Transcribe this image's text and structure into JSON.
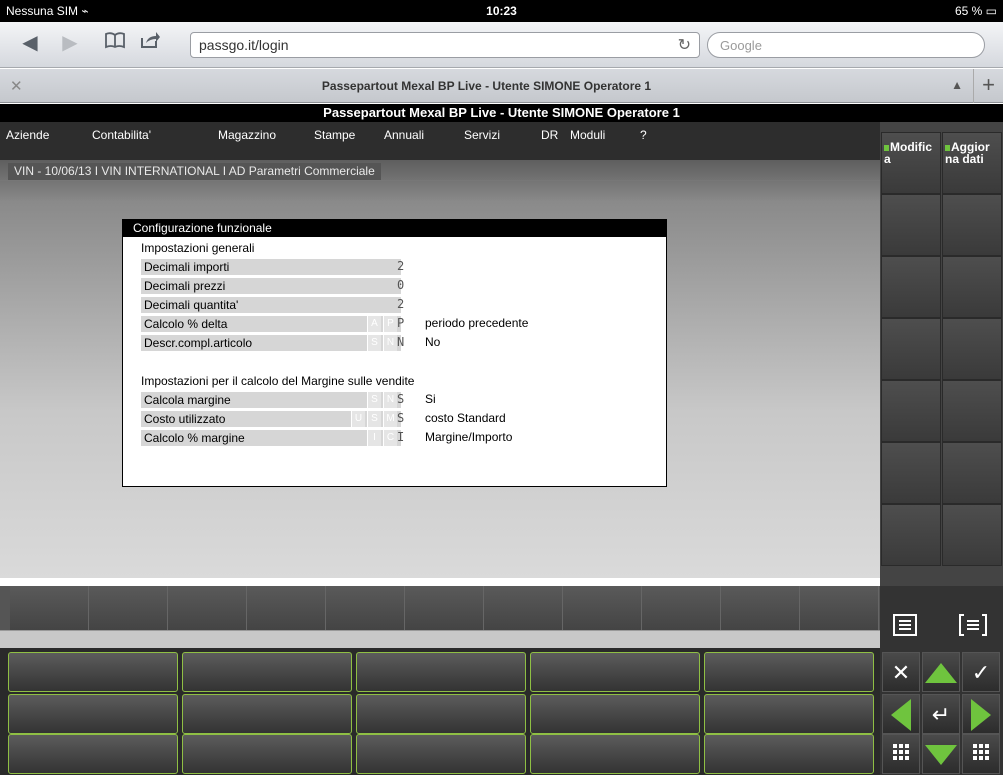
{
  "status": {
    "carrier": "Nessuna SIM",
    "time": "10:23",
    "battery": "65 %"
  },
  "browser": {
    "url": "passgo.it/login",
    "search_placeholder": "Google",
    "tab_title": "Passepartout Mexal BP Live - Utente SIMONE Operatore 1",
    "icons": [
      "back-icon",
      "forward-icon",
      "bookmarks-icon",
      "share-icon",
      "reload-icon",
      "lock-icon",
      "plus-icon",
      "close-icon"
    ]
  },
  "app": {
    "title": "Passepartout Mexal BP Live - Utente SIMONE Operatore 1",
    "menu": [
      "Aziende",
      "Contabilita'",
      "Magazzino",
      "Stampe",
      "Annuali",
      "Servizi",
      "DR",
      "Moduli",
      "?"
    ],
    "breadcrumb": "VIN - 10/06/13 I VIN INTERNATIONAL  I AD Parametri Commerciale"
  },
  "dialog": {
    "title": "Configurazione funzionale",
    "section1": "Impostazioni generali",
    "section2": "Impostazioni per il calcolo del Margine sulle vendite",
    "rows": [
      {
        "label": "Decimali importi",
        "options": [],
        "value": "2",
        "desc": ""
      },
      {
        "label": "Decimali prezzi",
        "options": [],
        "value": "0",
        "desc": ""
      },
      {
        "label": "Decimali quantita'",
        "options": [],
        "value": "2",
        "desc": ""
      },
      {
        "label": "Calcolo % delta",
        "options": [
          "A",
          "P"
        ],
        "value": "P",
        "desc": "periodo precedente"
      },
      {
        "label": "Descr.compl.articolo",
        "options": [
          "S",
          "N"
        ],
        "value": "N",
        "desc": "No"
      },
      {
        "label": "Calcola margine",
        "options": [
          "S",
          "N"
        ],
        "value": "S",
        "desc": "Si"
      },
      {
        "label": "Costo utilizzato",
        "options": [
          "U",
          "S",
          "M"
        ],
        "value": "S",
        "desc": "costo Standard"
      },
      {
        "label": "Calcolo % margine",
        "options": [
          "I",
          "C"
        ],
        "value": "I",
        "desc": "Margine/Importo"
      }
    ]
  },
  "side": {
    "modifica": "Modific a",
    "aggiorna": "Aggior na dati"
  },
  "colors": {
    "accent_green": "#6fc43e",
    "menubar": "#2d2d2d",
    "title_bg": "#000000"
  }
}
